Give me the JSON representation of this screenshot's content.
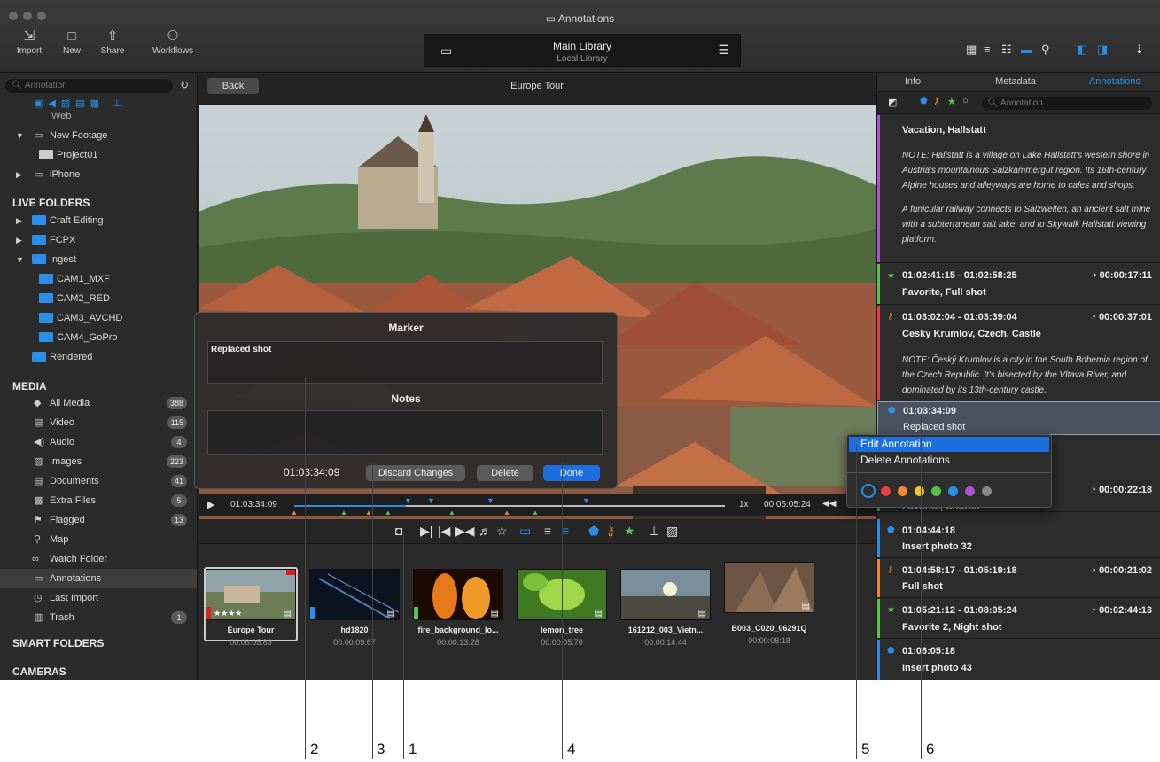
{
  "window": {
    "title": "Annotations"
  },
  "toolbar": {
    "import": "Import",
    "new": "New",
    "share": "Share",
    "workflows": "Workflows"
  },
  "library": {
    "name": "Main Library",
    "sub": "Local Library"
  },
  "sidebar": {
    "search_placeholder": "Annotation",
    "tree": {
      "web": "Web",
      "new_footage": "New Footage",
      "project01": "Project01",
      "iphone": "iPhone"
    },
    "live_folders_header": "LIVE FOLDERS",
    "live": {
      "craft": "Craft Editing",
      "fcpx": "FCPX",
      "ingest": "Ingest",
      "cam1": "CAM1_MXF",
      "cam2": "CAM2_RED",
      "cam3": "CAM3_AVCHD",
      "cam4": "CAM4_GoPro",
      "rendered": "Rendered"
    },
    "media_header": "MEDIA",
    "media": {
      "all": "All Media",
      "all_c": "388",
      "video": "Video",
      "video_c": "115",
      "audio": "Audio",
      "audio_c": "4",
      "images": "Images",
      "images_c": "223",
      "docs": "Documents",
      "docs_c": "41",
      "extra": "Extra Files",
      "extra_c": "5",
      "flagged": "Flagged",
      "flagged_c": "13",
      "map": "Map",
      "watch": "Watch Folder",
      "annotations": "Annotations",
      "last": "Last Import",
      "trash": "Trash",
      "trash_c": "1"
    },
    "smart_header": "SMART FOLDERS",
    "cameras_header": "CAMERAS"
  },
  "viewer": {
    "back": "Back",
    "title": "Europe Tour"
  },
  "marker_dialog": {
    "marker_title": "Marker",
    "marker_text": "Replaced shot",
    "notes_title": "Notes",
    "timecode": "01:03:34:09",
    "discard": "Discard Changes",
    "delete": "Delete",
    "done": "Done"
  },
  "scrubber": {
    "current": "01:03:34:09",
    "speed": "1x",
    "duration": "00:06:05:24"
  },
  "clips": [
    {
      "name": "Europe Tour",
      "dur": "00:06:05.83",
      "stars": "★★★★"
    },
    {
      "name": "hd1820",
      "dur": "00:00:09.67"
    },
    {
      "name": "fire_background_lo...",
      "dur": "00:00:13.28"
    },
    {
      "name": "lemon_tree",
      "dur": "00:00:05.76"
    },
    {
      "name": "161212_003_Vietn...",
      "dur": "00:00:14.44"
    },
    {
      "name": "B003_C020_06291Q",
      "dur": "00:00:08:18"
    }
  ],
  "inspector": {
    "tabs": {
      "info": "Info",
      "metadata": "Metadata",
      "annotations": "Annotations"
    },
    "search_placeholder": "Annotation",
    "a0": {
      "title": "Vacation, Hallstatt",
      "note1": "NOTE: Hallstatt is a village on Lake Hallstatt's western shore in Austria's mountainous Salzkammergut region. Its 16th-century Alpine houses and alleyways are home to cafes and shops.",
      "note2": "A funicular railway connects to Salzwelten, an ancient salt mine with a subterranean salt lake, and to Skywalk Hallstatt viewing platform."
    },
    "a1": {
      "tc": "01:02:41:15 - 01:02:58:25",
      "dur": "00:00:17:11",
      "title": "Favorite,  Full shot"
    },
    "a2": {
      "tc": "01:03:02:04 - 01:03:39:04",
      "dur": "00:00:37:01",
      "title": "Cesky Krumlov, Czech, Castle",
      "note": "NOTE: Český Krumlov is a city in the South Bohemia region of the Czech Republic. It's bisected by the Vltava River, and dominated by its 13th-century castle."
    },
    "a3": {
      "tc": "01:03:34:09",
      "title": "Replaced shot"
    },
    "a4": {
      "dur": "00:00:22:18",
      "title": "Favorite,  Church"
    },
    "a5": {
      "tc": "01:04:44:18",
      "title": "Insert photo 32"
    },
    "a6": {
      "tc": "01:04:58:17 - 01:05:19:18",
      "dur": "00:00:21:02",
      "title": "Full shot"
    },
    "a7": {
      "tc": "01:05:21:12 - 01:08:05:24",
      "dur": "00:02:44:13",
      "title": "Favorite 2,  Night shot"
    },
    "a8": {
      "tc": "01:06:05:18",
      "title": "Insert photo 43"
    }
  },
  "context_menu": {
    "edit": "Edit Annotation",
    "delete": "Delete Annotations"
  },
  "callouts": [
    "2",
    "3",
    "1",
    "4",
    "5",
    "6"
  ]
}
